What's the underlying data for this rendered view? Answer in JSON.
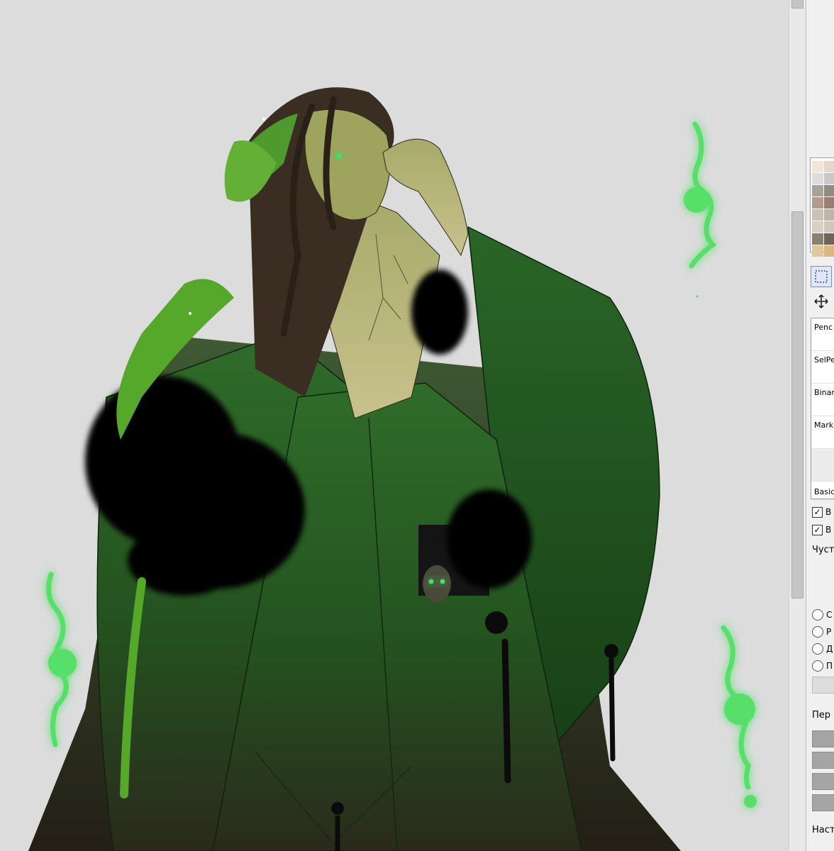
{
  "panel": {
    "brushes": [
      {
        "label": "Penc"
      },
      {
        "label": "SelPe"
      },
      {
        "label": "Binar"
      },
      {
        "label": "Mark"
      },
      {
        "label": ""
      },
      {
        "label": "Basic"
      }
    ],
    "checkboxes": [
      {
        "label": "B",
        "checked": "✓"
      },
      {
        "label": "B",
        "checked": "✓"
      }
    ],
    "section_label_1": "Чуст",
    "radios": [
      {
        "label": "C"
      },
      {
        "label": "P"
      },
      {
        "label": "Д"
      },
      {
        "label": "П"
      }
    ],
    "section_label_2": "Пер",
    "section_label_3": "Наст"
  },
  "palette_colors": [
    "#f3e4d8",
    "#e6d6cc",
    "#dcdcdc",
    "#c8c8c8",
    "#a8a39a",
    "#8f8a82",
    "#b59a8e",
    "#9a7e72",
    "#c9c1b6",
    "#bdb5aa",
    "#d7d0c6",
    "#cfc7bc",
    "#8b7f70",
    "#6f6457",
    "#e2c79c",
    "#d9b882"
  ],
  "colors": {
    "canvas_bg": "#dcdcdc",
    "robe_dark": "#1f4a1c",
    "robe_mid": "#2e6a29",
    "skin": "#b7b77a",
    "hair": "#3a2e22",
    "flame": "#57e06a"
  }
}
